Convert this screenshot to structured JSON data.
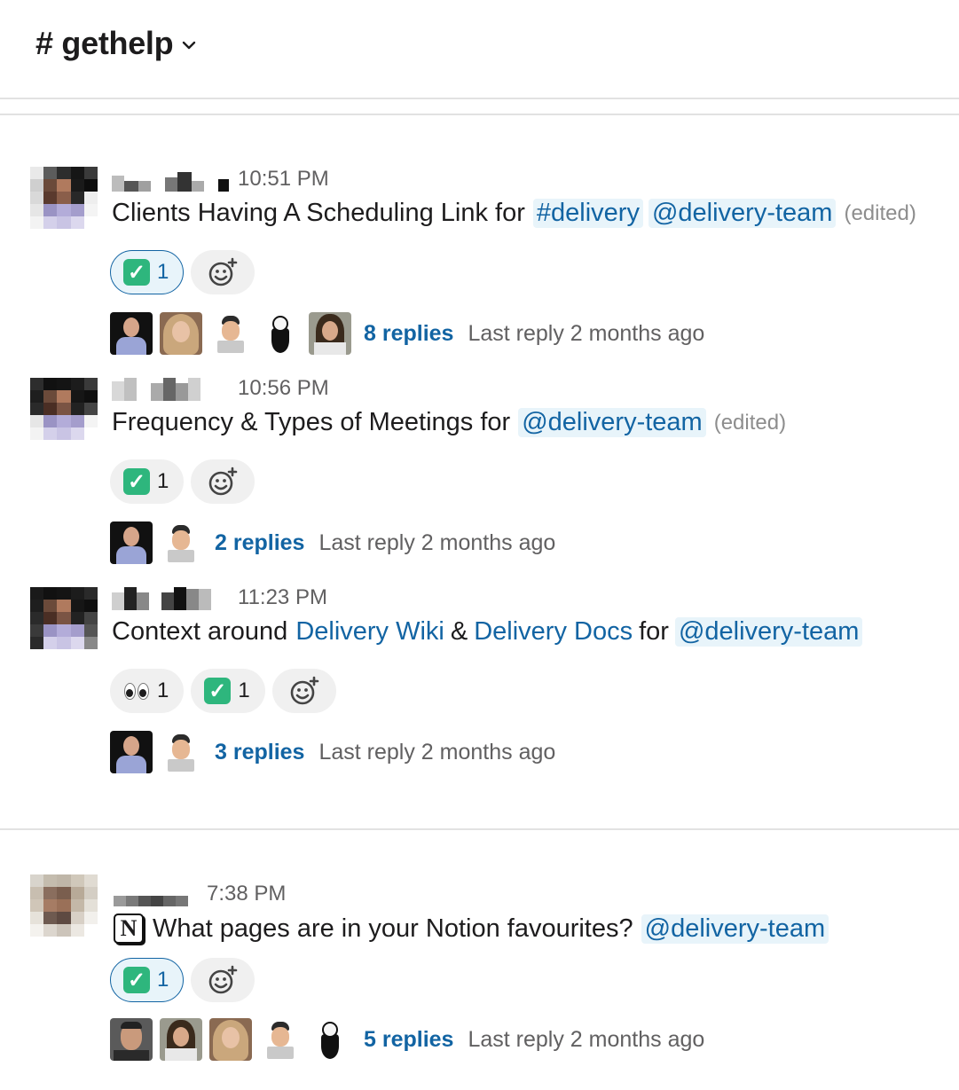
{
  "channel": {
    "name": "# gethelp"
  },
  "messages": [
    {
      "time": "10:51 PM",
      "text": [
        "Clients Having A Scheduling Link for",
        "#delivery",
        "@delivery-team",
        "(edited)"
      ],
      "reactions": [
        {
          "emoji": "check-mark-emoji",
          "count": "1",
          "mine": true
        }
      ],
      "thread": {
        "replies": "8 replies",
        "last": "Last reply 2 months ago"
      }
    },
    {
      "time": "10:56 PM",
      "text": [
        "Frequency & Types of Meetings for",
        "@delivery-team",
        "(edited)"
      ],
      "reactions": [
        {
          "emoji": "check-mark-emoji",
          "count": "1",
          "mine": false
        }
      ],
      "thread": {
        "replies": "2 replies",
        "last": "Last reply 2 months ago"
      }
    },
    {
      "time": "11:23 PM",
      "text": [
        "Context around",
        "Delivery Wiki",
        "&",
        "Delivery Docs",
        "for",
        "@delivery-team"
      ],
      "reactions": [
        {
          "emoji": "eyes-emoji",
          "count": "1",
          "mine": false
        },
        {
          "emoji": "check-mark-emoji",
          "count": "1",
          "mine": false
        }
      ],
      "thread": {
        "replies": "3 replies",
        "last": "Last reply 2 months ago"
      }
    },
    {
      "time": "7:38 PM",
      "text": [
        "What pages are in your Notion favourites?",
        "@delivery-team"
      ],
      "notion_icon_letter": "N",
      "reactions": [
        {
          "emoji": "check-mark-emoji",
          "count": "1",
          "mine": true
        }
      ],
      "thread": {
        "replies": "5 replies",
        "last": "Last reply 2 months ago"
      }
    }
  ],
  "colors": {
    "link": "#1264a3",
    "mention_bg": "#e8f4fa",
    "check_green": "#2eb67d",
    "muted": "#616061"
  },
  "icons": {
    "channel_menu": "chevron-down-icon",
    "add_reaction": "add-reaction-icon",
    "check": "check-mark-emoji",
    "eyes": "eyes-emoji"
  }
}
